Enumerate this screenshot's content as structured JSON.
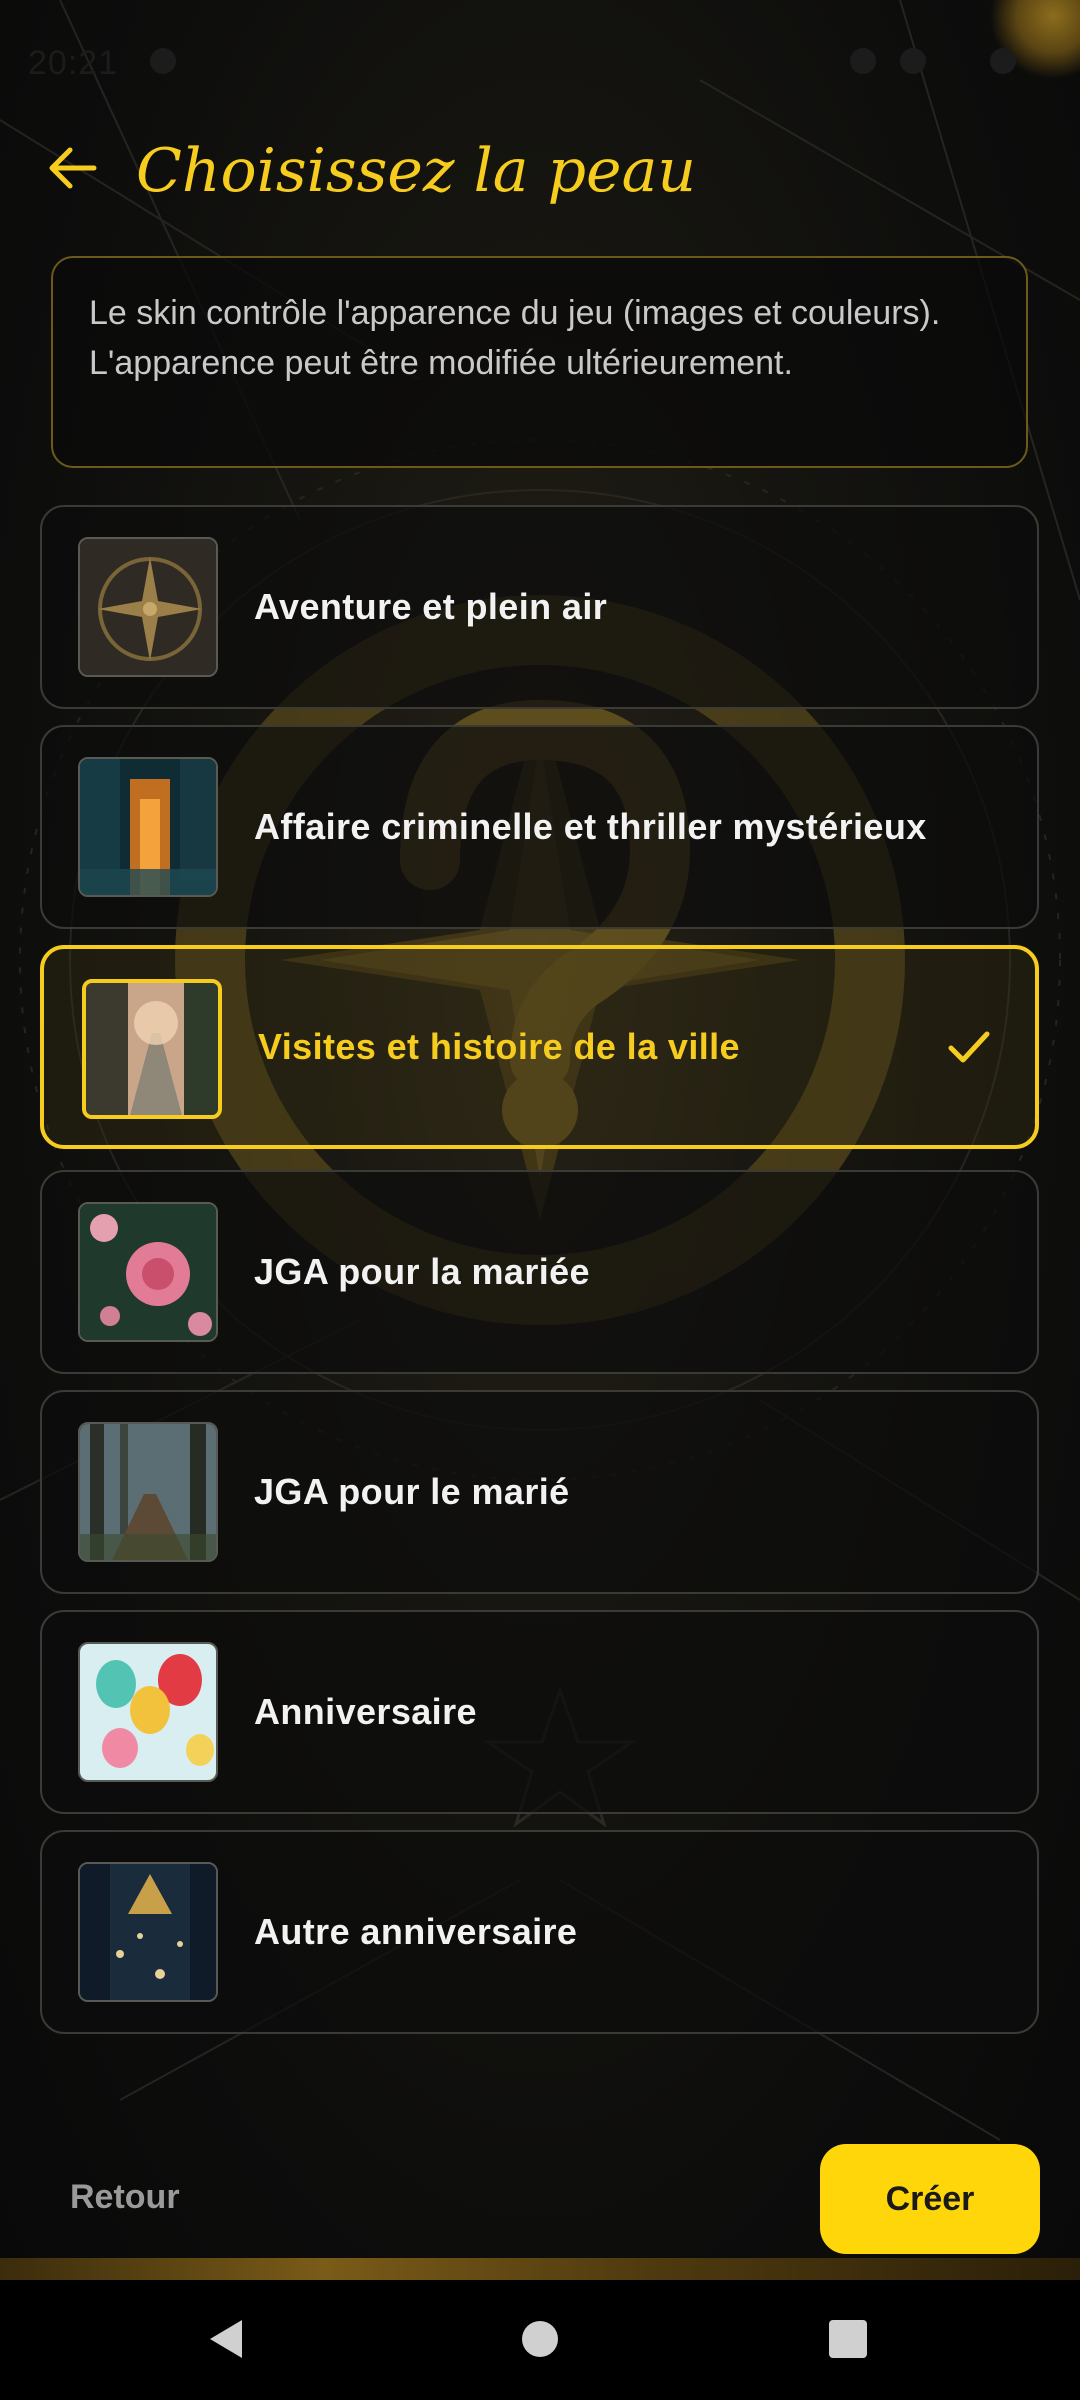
{
  "status": {
    "time": "20:21"
  },
  "header": {
    "title": "Choisissez la peau"
  },
  "info": {
    "text": "Le skin contrôle l'apparence du jeu (images et couleurs). L'apparence peut être modifiée ultérieurement."
  },
  "skins": [
    {
      "label": "Aventure et plein air",
      "icon": "compass-thumbnail",
      "selected": false
    },
    {
      "label": "Affaire criminelle et thriller mystérieux",
      "icon": "night-city-thumbnail",
      "selected": false
    },
    {
      "label": "Visites et histoire de la ville",
      "icon": "old-street-thumbnail",
      "selected": true
    },
    {
      "label": "JGA pour la mariée",
      "icon": "pink-flowers-thumbnail",
      "selected": false
    },
    {
      "label": "JGA pour le marié",
      "icon": "forest-path-thumbnail",
      "selected": false
    },
    {
      "label": "Anniversaire",
      "icon": "balloons-thumbnail",
      "selected": false
    },
    {
      "label": "Autre anniversaire",
      "icon": "chandelier-thumbnail",
      "selected": false
    }
  ],
  "actions": {
    "back_label": "Retour",
    "create_label": "Créer"
  },
  "colors": {
    "accent": "#f6cc1e",
    "button": "#ffd60a",
    "background": "#0d0d0c"
  }
}
